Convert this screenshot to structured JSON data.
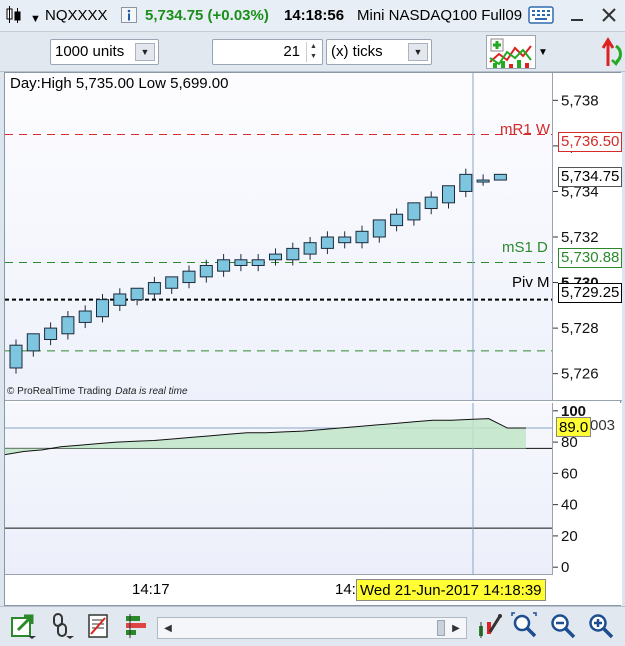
{
  "title_bar": {
    "symbol": "NQXXXX",
    "price_change": "5,734.75 (+0.03%)",
    "time": "14:18:56",
    "instrument_name": "Mini NASDAQ100 Full09"
  },
  "toolbar": {
    "units_value": "1000 units",
    "ticks_value": "21",
    "ticks_unit": "(x) ticks"
  },
  "chart": {
    "info_text": "Day:High 5,735.00 Low 5,699.00",
    "copyright": "© ProRealTime Trading",
    "realtime_note": "Data is real time",
    "levels": {
      "mr1_label": "mR1 W",
      "ms1_label": "mS1 D",
      "piv_label": "Piv M"
    },
    "price_tags": {
      "mr1": "5,736.50",
      "last": "5,734.75",
      "ms1": "5,730.88",
      "piv": "5,729.25"
    },
    "indicator_tags": {
      "value": "89.0",
      "hidden_value": "003"
    },
    "time_labels": {
      "t1": "14:17",
      "t2": "14:",
      "crosshair_date": "Wed 21-Jun-2017 14:18:39"
    },
    "colors": {
      "candle_fill": "#7ec6e0",
      "resistance": "#d42a2a",
      "support": "#2a8a2a",
      "pivot": "#000000",
      "crosshair_tag": "#ffff33",
      "indicator_fill": "#bfe6c8"
    }
  },
  "chart_data": {
    "type": "candlestick",
    "y_axis": {
      "ticks": [
        5726,
        5728,
        5730,
        5732,
        5734,
        5736,
        5738
      ],
      "ylim": [
        5724.8,
        5739.2
      ],
      "bold_tick": 5730
    },
    "levels": [
      {
        "name": "mR1 W",
        "value": 5736.5
      },
      {
        "name": "mS1 D",
        "value": 5730.88
      },
      {
        "name": "Piv M",
        "value": 5729.25
      },
      {
        "name": "",
        "value": 5727.0
      }
    ],
    "candles": [
      {
        "o": 5726.25,
        "h": 5727.5,
        "l": 5726.0,
        "c": 5727.25
      },
      {
        "o": 5727.0,
        "h": 5727.75,
        "l": 5726.75,
        "c": 5727.75
      },
      {
        "o": 5727.5,
        "h": 5728.25,
        "l": 5727.25,
        "c": 5728.0
      },
      {
        "o": 5727.75,
        "h": 5728.75,
        "l": 5727.5,
        "c": 5728.5
      },
      {
        "o": 5728.25,
        "h": 5729.0,
        "l": 5728.0,
        "c": 5728.75
      },
      {
        "o": 5728.5,
        "h": 5729.5,
        "l": 5728.25,
        "c": 5729.25
      },
      {
        "o": 5729.0,
        "h": 5729.75,
        "l": 5728.75,
        "c": 5729.5
      },
      {
        "o": 5729.25,
        "h": 5729.75,
        "l": 5729.0,
        "c": 5729.75
      },
      {
        "o": 5729.5,
        "h": 5730.25,
        "l": 5729.25,
        "c": 5730.0
      },
      {
        "o": 5729.75,
        "h": 5730.25,
        "l": 5729.5,
        "c": 5730.25
      },
      {
        "o": 5730.0,
        "h": 5730.75,
        "l": 5729.75,
        "c": 5730.5
      },
      {
        "o": 5730.25,
        "h": 5731.0,
        "l": 5730.0,
        "c": 5730.75
      },
      {
        "o": 5730.5,
        "h": 5731.25,
        "l": 5730.25,
        "c": 5731.0
      },
      {
        "o": 5730.75,
        "h": 5731.25,
        "l": 5730.5,
        "c": 5731.0
      },
      {
        "o": 5730.75,
        "h": 5731.25,
        "l": 5730.5,
        "c": 5731.0
      },
      {
        "o": 5731.0,
        "h": 5731.5,
        "l": 5730.75,
        "c": 5731.25
      },
      {
        "o": 5731.0,
        "h": 5731.75,
        "l": 5730.75,
        "c": 5731.5
      },
      {
        "o": 5731.25,
        "h": 5732.0,
        "l": 5731.0,
        "c": 5731.75
      },
      {
        "o": 5731.5,
        "h": 5732.25,
        "l": 5731.25,
        "c": 5732.0
      },
      {
        "o": 5731.75,
        "h": 5732.25,
        "l": 5731.5,
        "c": 5732.0
      },
      {
        "o": 5731.75,
        "h": 5732.5,
        "l": 5731.5,
        "c": 5732.25
      },
      {
        "o": 5732.0,
        "h": 5732.75,
        "l": 5731.75,
        "c": 5732.75
      },
      {
        "o": 5732.5,
        "h": 5733.25,
        "l": 5732.25,
        "c": 5733.0
      },
      {
        "o": 5732.75,
        "h": 5733.5,
        "l": 5732.5,
        "c": 5733.5
      },
      {
        "o": 5733.25,
        "h": 5734.0,
        "l": 5733.0,
        "c": 5733.75
      },
      {
        "o": 5733.5,
        "h": 5734.25,
        "l": 5733.25,
        "c": 5734.25
      },
      {
        "o": 5734.0,
        "h": 5735.0,
        "l": 5733.75,
        "c": 5734.75
      },
      {
        "o": 5734.5,
        "h": 5734.75,
        "l": 5734.25,
        "c": 5734.5
      },
      {
        "o": 5734.5,
        "h": 5734.75,
        "l": 5734.5,
        "c": 5734.75
      }
    ],
    "indicator": {
      "y_axis": {
        "ticks": [
          0,
          20,
          40,
          60,
          80,
          100
        ],
        "ylim": [
          -5,
          105
        ]
      },
      "reference_lines": [
        76,
        25
      ],
      "crosshair_level": 89,
      "values": [
        72,
        74,
        75,
        77,
        78,
        79,
        80,
        80.5,
        81,
        82,
        83,
        84,
        85,
        86,
        86,
        86.5,
        87,
        88,
        89,
        90,
        91,
        92,
        93,
        94,
        94,
        94.5,
        95,
        89,
        89
      ]
    }
  }
}
